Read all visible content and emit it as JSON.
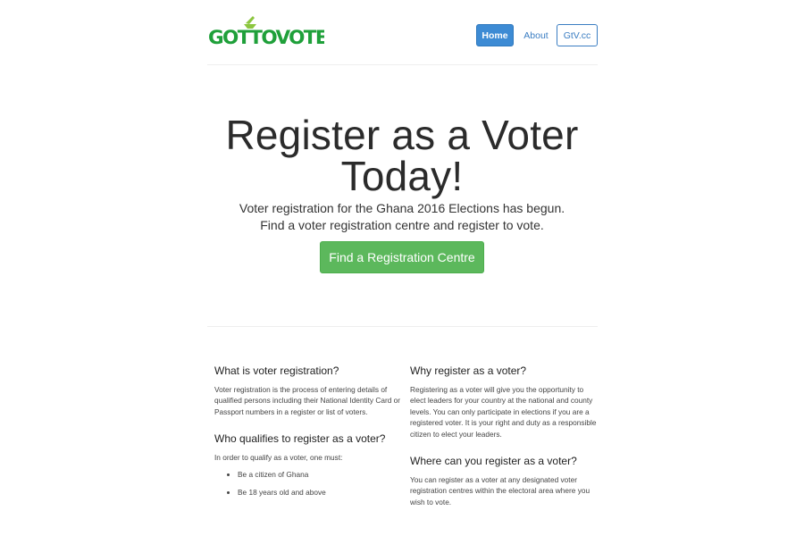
{
  "header": {
    "logo_text": "GOTTOVOTE",
    "nav": {
      "home_label": "Home",
      "about_label": "About",
      "gtv_label": "GtV.cc"
    }
  },
  "hero": {
    "title": "Register as a Voter Today!",
    "lead": "Voter registration for the Ghana 2016 Elections has begun. Find a voter registration centre and register to vote.",
    "cta_label": "Find a Registration Centre"
  },
  "info": {
    "left": [
      {
        "heading": "What is voter registration?",
        "body": "Voter registration is the process of entering details of qualified persons including their National Identity Card or Passport numbers in a register or list of voters."
      },
      {
        "heading": "Who qualifies to register as a voter?",
        "body": "In order to qualify as a voter, one must:",
        "list": [
          "Be a citizen of Ghana",
          "Be 18 years old and above"
        ]
      }
    ],
    "right": [
      {
        "heading": "Why register as a voter?",
        "body": "Registering as a voter will give you the opportunity to elect leaders for your country at the national and county levels. You can only participate in elections if you are a registered voter. It is your right and duty as a responsible citizen to elect your leaders."
      },
      {
        "heading": "Where can you register as a voter?",
        "body": "You can register as a voter at any designated voter registration centres within the electoral area where you wish to vote."
      }
    ]
  },
  "colors": {
    "logo_green": "#1fa03a",
    "logo_lime": "#8cc63f",
    "primary_blue": "#3d8bd4",
    "cta_green": "#5cb85c"
  }
}
